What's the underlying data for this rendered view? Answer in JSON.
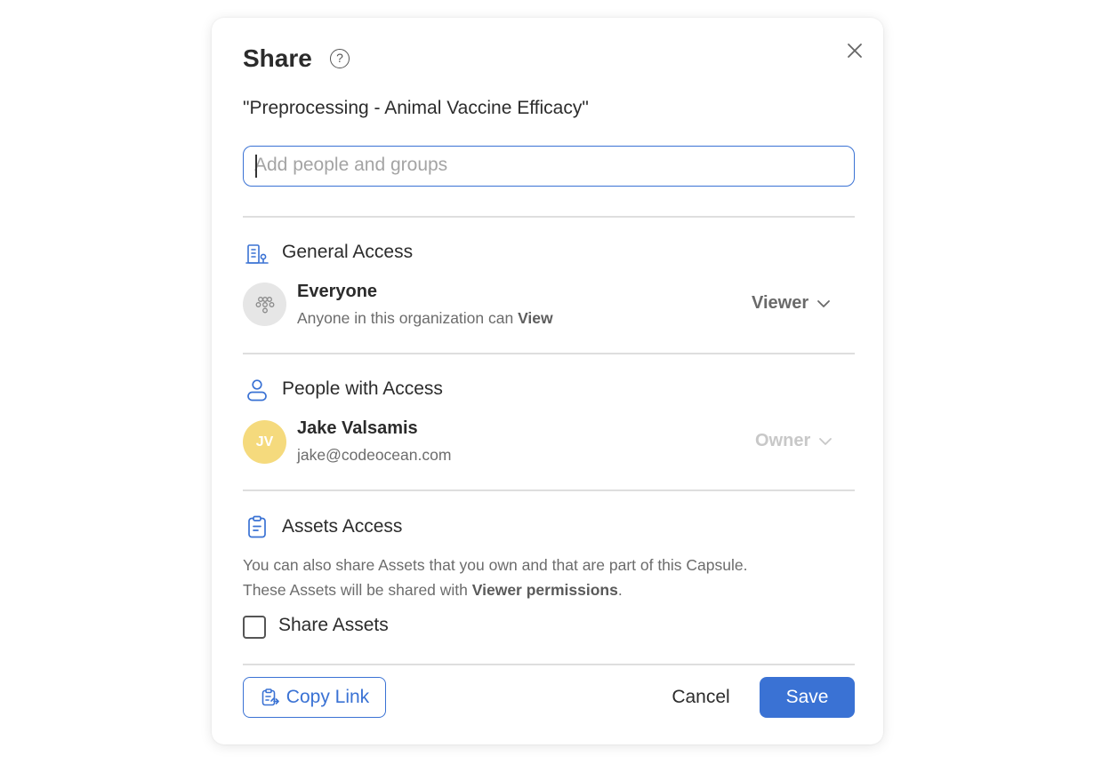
{
  "dialog": {
    "title": "Share",
    "capsule_name": "\"Preprocessing - Animal Vaccine Efficacy\""
  },
  "search": {
    "placeholder": "Add people and groups",
    "value": ""
  },
  "general_access": {
    "title": "General Access",
    "entry": {
      "name": "Everyone",
      "desc_prefix": "Anyone in this organization can ",
      "desc_bold": "View",
      "role": "Viewer"
    }
  },
  "people_access": {
    "title": "People with Access",
    "people": [
      {
        "initials": "JV",
        "name": "Jake Valsamis",
        "email": "jake@codeocean.com",
        "role": "Owner"
      }
    ]
  },
  "assets_access": {
    "title": "Assets Access",
    "desc_line1": "You can also share Assets that you own and that are part of this Capsule.",
    "desc_line2_prefix": "These Assets will be shared with ",
    "desc_line2_bold": "Viewer permissions",
    "desc_line2_suffix": ".",
    "checkbox_label": "Share Assets",
    "checked": false
  },
  "footer": {
    "copy_link": "Copy Link",
    "cancel": "Cancel",
    "save": "Save"
  },
  "colors": {
    "accent": "#3a72d4",
    "avatar_jv": "#f5da7d",
    "avatar_everyone": "#e6e6e6"
  },
  "icons": {
    "help": "question-circle-icon",
    "close": "close-icon",
    "general_access": "building-icon",
    "everyone": "group-icon",
    "people_access": "person-icon",
    "assets_access": "clipboard-icon",
    "role_dropdown": "chevron-down-icon",
    "copy_link": "clipboard-link-icon"
  }
}
